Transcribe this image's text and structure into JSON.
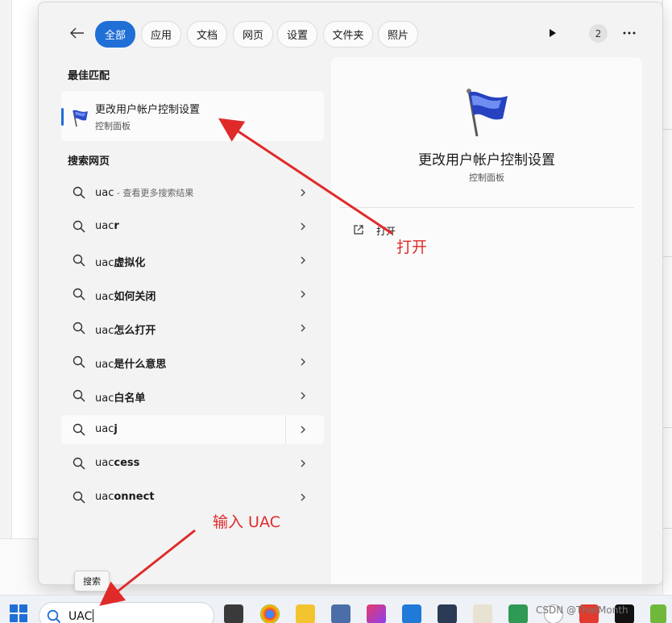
{
  "filter_bar": {
    "tabs": [
      {
        "label": "全部",
        "active": true
      },
      {
        "label": "应用"
      },
      {
        "label": "文档"
      },
      {
        "label": "网页"
      },
      {
        "label": "设置"
      },
      {
        "label": "文件夹"
      },
      {
        "label": "照片"
      }
    ],
    "badge_count": "2"
  },
  "best_match": {
    "heading": "最佳匹配",
    "title": "更改用户帐户控制设置",
    "subtitle": "控制面板",
    "icon": "uac-flag-icon"
  },
  "web_search": {
    "heading": "搜索网页",
    "first": {
      "prefix": "uac",
      "hint": " - 查看更多搜索结果"
    },
    "results": [
      {
        "prefix": "uac",
        "suffix": "r"
      },
      {
        "prefix": "uac",
        "suffix": "虚拟化"
      },
      {
        "prefix": "uac",
        "suffix": "如何关闭"
      },
      {
        "prefix": "uac",
        "suffix": "怎么打开"
      },
      {
        "prefix": "uac",
        "suffix": "是什么意思"
      },
      {
        "prefix": "uac",
        "suffix": "白名单"
      },
      {
        "prefix": "uac",
        "suffix": "j"
      },
      {
        "prefix": "uac",
        "suffix": "cess"
      },
      {
        "prefix": "uac",
        "suffix": "onnect"
      }
    ]
  },
  "preview": {
    "title": "更改用户帐户控制设置",
    "subtitle": "控制面板",
    "action_open": "打开"
  },
  "taskbar": {
    "search_value": "UAC",
    "search_tooltip": "搜索"
  },
  "annotations": {
    "open_label": "打开",
    "input_label": "输入 UAC"
  },
  "watermark": "CSDN @ThatMonth",
  "colors": {
    "accent": "#1f6fd6",
    "annotation_red": "#e02a2a",
    "panel_bg": "#f3f3f3"
  }
}
